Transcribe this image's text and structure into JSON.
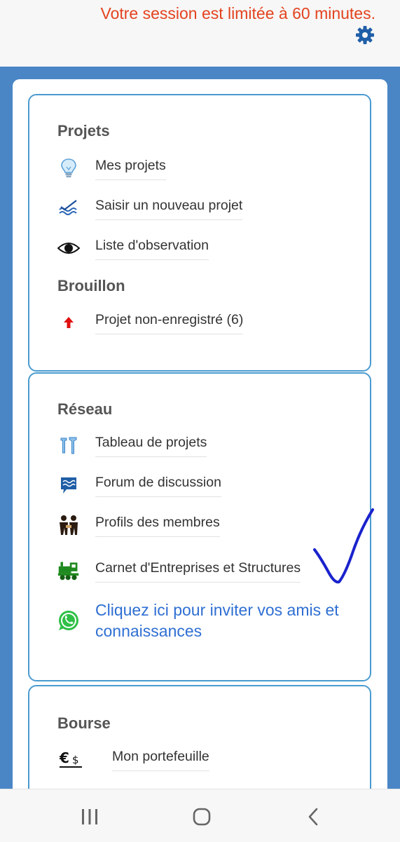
{
  "header": {
    "session_notice": "Votre session est limitée à 60 minutes."
  },
  "projets": {
    "title": "Projets",
    "items": [
      {
        "label": "Mes projets",
        "icon": "lightbulb-icon"
      },
      {
        "label": "Saisir un nouveau projet",
        "icon": "checklist-icon"
      },
      {
        "label": "Liste d'observation",
        "icon": "eye-icon"
      }
    ]
  },
  "brouillon": {
    "title": "Brouillon",
    "items": [
      {
        "label": "Projet non-enregistré (6)",
        "icon": "arrow-up-icon"
      }
    ]
  },
  "reseau": {
    "title": "Réseau",
    "items": [
      {
        "label": "Tableau de projets",
        "icon": "tools-icon"
      },
      {
        "label": "Forum de discussion",
        "icon": "chat-icon"
      },
      {
        "label": "Profils des membres",
        "icon": "people-icon"
      },
      {
        "label": "Carnet d'Entreprises et Structures",
        "icon": "train-icon"
      }
    ],
    "invite": "Cliquez ici pour inviter vos amis et connaissances"
  },
  "bourse": {
    "title": "Bourse",
    "items": [
      {
        "label": "Mon portefeuille",
        "icon": "euro-dollar-icon"
      }
    ]
  },
  "colors": {
    "accent": "#4a86c6",
    "card_border": "#4a9bd0",
    "notice": "#e3431f",
    "link": "#2f6fd3"
  }
}
